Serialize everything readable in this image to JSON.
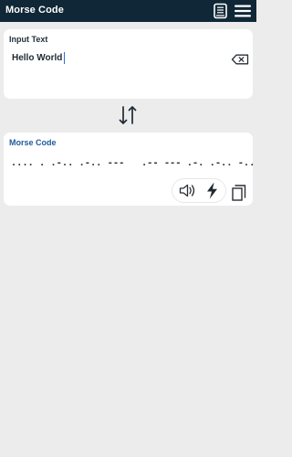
{
  "header": {
    "title": "Morse Code",
    "icons": {
      "reference": "book-icon",
      "menu": "hamburger-menu-icon"
    }
  },
  "input_card": {
    "label": "Input Text",
    "value": "Hello World",
    "clear_icon": "backspace-icon"
  },
  "swap_icon": "swap-vertical-icon",
  "morse_card": {
    "label": "Morse Code",
    "output": ".... . .-.. .-.. ---   .-- --- .-. .-.. -..",
    "icons": {
      "sound": "speaker-icon",
      "flash": "lightning-icon",
      "copy": "copy-icon"
    }
  },
  "colors": {
    "header_background": "#0f2736",
    "page_background": "#ececec",
    "accent": "#1f5a9e",
    "cursor": "#2d6bd6"
  }
}
